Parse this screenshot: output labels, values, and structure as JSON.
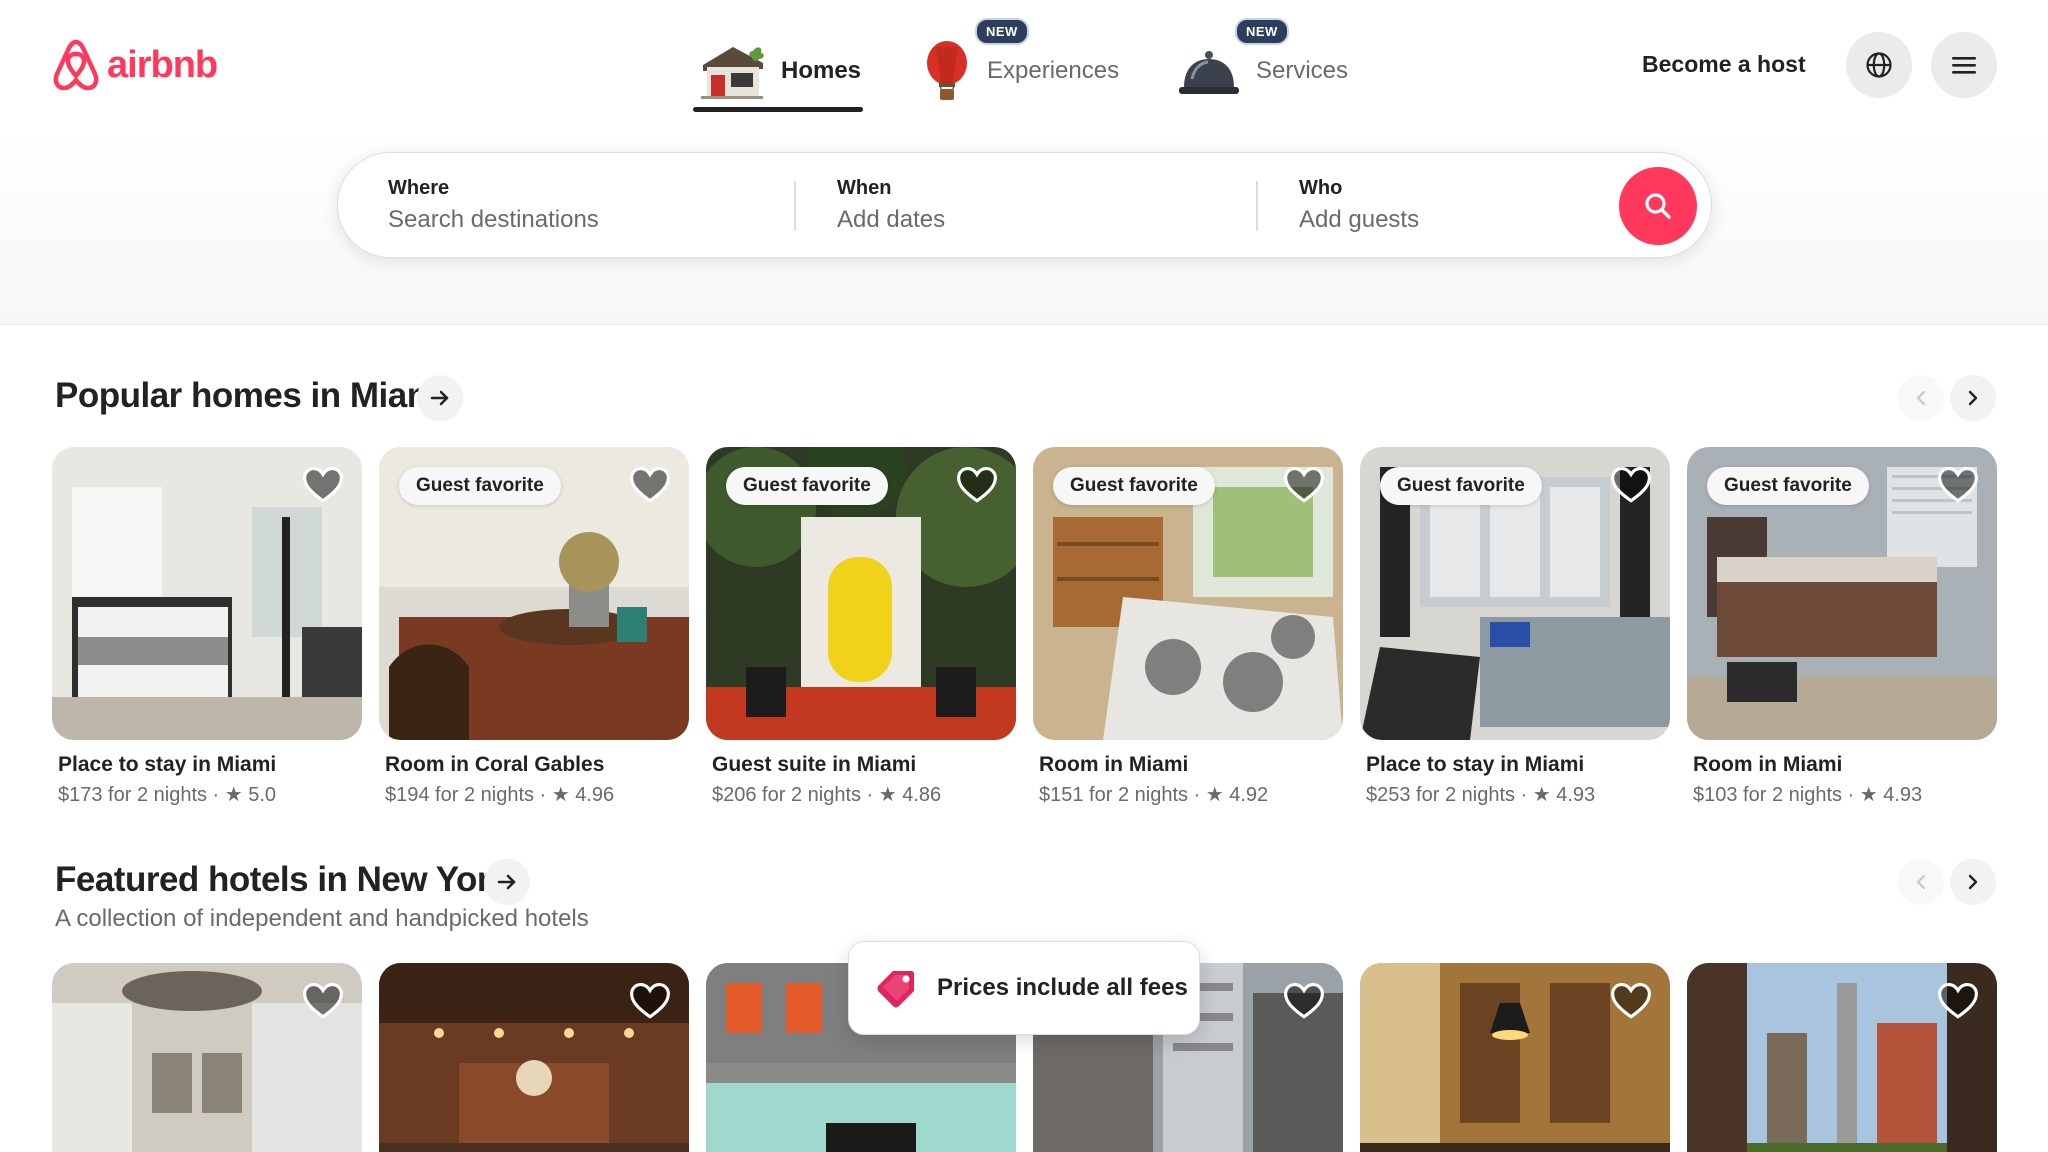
{
  "brand": {
    "name": "airbnb",
    "color": "#ff385c"
  },
  "nav": {
    "homes": {
      "label": "Homes",
      "icon": "house-icon"
    },
    "experiences": {
      "label": "Experiences",
      "badge": "NEW",
      "icon": "hot-air-balloon-icon"
    },
    "services": {
      "label": "Services",
      "badge": "NEW",
      "icon": "service-bell-icon"
    }
  },
  "header": {
    "become_host": "Become a host",
    "globe_icon": "globe-icon",
    "menu_icon": "hamburger-menu-icon"
  },
  "search": {
    "where": {
      "label": "Where",
      "placeholder": "Search destinations"
    },
    "when": {
      "label": "When",
      "placeholder": "Add dates"
    },
    "who": {
      "label": "Who",
      "placeholder": "Add guests"
    },
    "button_icon": "search-icon"
  },
  "popular": {
    "title": "Popular homes in Miami",
    "listings": [
      {
        "title": "Place to stay in Miami",
        "meta": "$173 for 2 nights · ★ 5.0",
        "badge": ""
      },
      {
        "title": "Room in Coral Gables",
        "meta": "$194 for 2 nights · ★ 4.96",
        "badge": "Guest favorite"
      },
      {
        "title": "Guest suite in Miami",
        "meta": "$206 for 2 nights · ★ 4.86",
        "badge": "Guest favorite"
      },
      {
        "title": "Room in Miami",
        "meta": "$151 for 2 nights · ★ 4.92",
        "badge": "Guest favorite"
      },
      {
        "title": "Place to stay in Miami",
        "meta": "$253 for 2 nights · ★ 4.93",
        "badge": "Guest favorite"
      },
      {
        "title": "Room in Miami",
        "meta": "$103 for 2 nights · ★ 4.93",
        "badge": "Guest favorite"
      }
    ]
  },
  "hotels": {
    "title": "Featured hotels in New York",
    "subtitle": "A collection of independent and handpicked hotels"
  },
  "toast": {
    "text": "Prices include all fees",
    "icon": "price-tag-icon"
  }
}
